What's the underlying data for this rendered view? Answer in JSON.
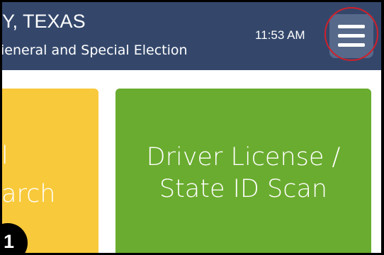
{
  "header": {
    "title": "Y, TEXAS",
    "subtitle": "ieneral and Special Election",
    "time": "11:53 AM",
    "menu_icon": "hamburger-menu-icon"
  },
  "tiles": [
    {
      "lines": [
        "l",
        "arch"
      ],
      "color": "#f8c93a"
    },
    {
      "lines": [
        "Driver License /",
        "State ID Scan"
      ],
      "color": "#6aac2f"
    }
  ],
  "annotation": {
    "step_number": "1",
    "highlight_color": "#d0202a"
  },
  "colors": {
    "header_bg": "#34476b",
    "menu_button_bg": "#57698a"
  }
}
